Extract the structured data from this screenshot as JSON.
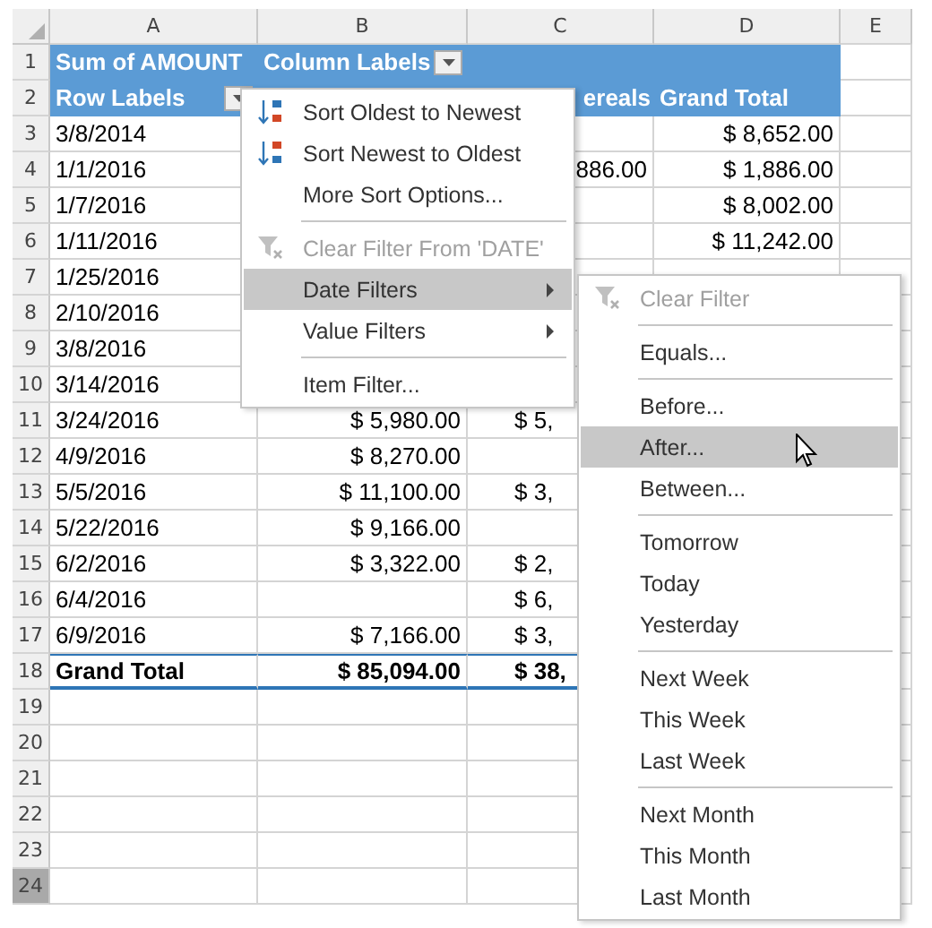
{
  "columns": [
    {
      "label": "A",
      "selected": false
    },
    {
      "label": "B",
      "selected": false
    },
    {
      "label": "C",
      "selected": false
    },
    {
      "label": "D",
      "selected": false
    },
    {
      "label": "E",
      "selected": false
    }
  ],
  "rows": [
    {
      "number": "1",
      "selected": false,
      "kind": "header",
      "cells": [
        {
          "kind": "text",
          "text": "Sum of AMOUNT",
          "filter": false
        },
        {
          "kind": "text",
          "text": "Column Labels",
          "filter": true
        },
        {
          "kind": "blank"
        },
        {
          "kind": "blank"
        },
        {
          "kind": "blank"
        }
      ]
    },
    {
      "number": "2",
      "selected": false,
      "kind": "header",
      "cells": [
        {
          "kind": "text",
          "text": "Row Labels",
          "filter": true
        },
        {
          "kind": "blank"
        },
        {
          "kind": "text",
          "text": "ereals",
          "filter": false
        },
        {
          "kind": "text",
          "text": "Grand Total",
          "filter": false
        },
        {
          "kind": "blank"
        }
      ]
    },
    {
      "number": "3",
      "selected": false,
      "kind": "data",
      "cells": [
        {
          "kind": "text",
          "text": "3/8/2014"
        },
        {
          "kind": "blank"
        },
        {
          "kind": "blank"
        },
        {
          "kind": "text",
          "text": "$ 8,652.00"
        },
        {
          "kind": "blank"
        }
      ]
    },
    {
      "number": "4",
      "selected": false,
      "kind": "data",
      "cells": [
        {
          "kind": "text",
          "text": "1/1/2016"
        },
        {
          "kind": "blank"
        },
        {
          "kind": "text",
          "text": "886.00"
        },
        {
          "kind": "text",
          "text": "$ 1,886.00"
        },
        {
          "kind": "blank"
        }
      ]
    },
    {
      "number": "5",
      "selected": false,
      "kind": "data",
      "cells": [
        {
          "kind": "text",
          "text": "1/7/2016"
        },
        {
          "kind": "blank"
        },
        {
          "kind": "blank"
        },
        {
          "kind": "text",
          "text": "$ 8,002.00"
        },
        {
          "kind": "blank"
        }
      ]
    },
    {
      "number": "6",
      "selected": false,
      "kind": "data",
      "cells": [
        {
          "kind": "text",
          "text": "1/11/2016"
        },
        {
          "kind": "blank"
        },
        {
          "kind": "blank"
        },
        {
          "kind": "text",
          "text": "$ 11,242.00"
        },
        {
          "kind": "blank"
        }
      ]
    },
    {
      "number": "7",
      "selected": false,
      "kind": "data",
      "cells": [
        {
          "kind": "text",
          "text": "1/25/2016"
        },
        {
          "kind": "blank"
        },
        {
          "kind": "blank"
        },
        {
          "kind": "blank"
        },
        {
          "kind": "blank"
        }
      ]
    },
    {
      "number": "8",
      "selected": false,
      "kind": "data",
      "cells": [
        {
          "kind": "text",
          "text": "2/10/2016"
        },
        {
          "kind": "blank"
        },
        {
          "kind": "blank"
        },
        {
          "kind": "blank"
        },
        {
          "kind": "blank"
        }
      ]
    },
    {
      "number": "9",
      "selected": false,
      "kind": "data",
      "cells": [
        {
          "kind": "text",
          "text": "3/8/2016"
        },
        {
          "kind": "blank"
        },
        {
          "kind": "blank"
        },
        {
          "kind": "blank"
        },
        {
          "kind": "blank"
        }
      ]
    },
    {
      "number": "10",
      "selected": false,
      "kind": "data",
      "cells": [
        {
          "kind": "text",
          "text": "3/14/2016"
        },
        {
          "kind": "blank"
        },
        {
          "kind": "blank"
        },
        {
          "kind": "blank"
        },
        {
          "kind": "blank"
        }
      ]
    },
    {
      "number": "11",
      "selected": false,
      "kind": "data",
      "cells": [
        {
          "kind": "text",
          "text": "3/24/2016"
        },
        {
          "kind": "text",
          "text": "$ 5,980.00"
        },
        {
          "kind": "text",
          "text": "$ 5,"
        },
        {
          "kind": "blank"
        },
        {
          "kind": "blank"
        }
      ]
    },
    {
      "number": "12",
      "selected": false,
      "kind": "data",
      "cells": [
        {
          "kind": "text",
          "text": "4/9/2016"
        },
        {
          "kind": "text",
          "text": "$ 8,270.00"
        },
        {
          "kind": "blank"
        },
        {
          "kind": "blank"
        },
        {
          "kind": "blank"
        }
      ]
    },
    {
      "number": "13",
      "selected": false,
      "kind": "data",
      "cells": [
        {
          "kind": "text",
          "text": "5/5/2016"
        },
        {
          "kind": "text",
          "text": "$ 11,100.00"
        },
        {
          "kind": "text",
          "text": "$ 3,"
        },
        {
          "kind": "blank"
        },
        {
          "kind": "blank"
        }
      ]
    },
    {
      "number": "14",
      "selected": false,
      "kind": "data",
      "cells": [
        {
          "kind": "text",
          "text": "5/22/2016"
        },
        {
          "kind": "text",
          "text": "$ 9,166.00"
        },
        {
          "kind": "blank"
        },
        {
          "kind": "blank"
        },
        {
          "kind": "blank"
        }
      ]
    },
    {
      "number": "15",
      "selected": false,
      "kind": "data",
      "cells": [
        {
          "kind": "text",
          "text": "6/2/2016"
        },
        {
          "kind": "text",
          "text": "$ 3,322.00"
        },
        {
          "kind": "text",
          "text": "$ 2,"
        },
        {
          "kind": "blank"
        },
        {
          "kind": "blank"
        }
      ]
    },
    {
      "number": "16",
      "selected": false,
      "kind": "data",
      "cells": [
        {
          "kind": "text",
          "text": "6/4/2016"
        },
        {
          "kind": "blank"
        },
        {
          "kind": "text",
          "text": "$ 6,"
        },
        {
          "kind": "blank"
        },
        {
          "kind": "blank"
        }
      ]
    },
    {
      "number": "17",
      "selected": false,
      "kind": "data",
      "cells": [
        {
          "kind": "text",
          "text": "6/9/2016"
        },
        {
          "kind": "text",
          "text": "$ 7,166.00"
        },
        {
          "kind": "text",
          "text": "$ 3,"
        },
        {
          "kind": "blank"
        },
        {
          "kind": "blank"
        }
      ]
    },
    {
      "number": "18",
      "selected": false,
      "kind": "total",
      "cells": [
        {
          "kind": "text",
          "text": "Grand Total"
        },
        {
          "kind": "text",
          "text": "$ 85,094.00"
        },
        {
          "kind": "text",
          "text": "$ 38,"
        },
        {
          "kind": "blank"
        },
        {
          "kind": "blank"
        }
      ]
    },
    {
      "number": "19",
      "selected": false,
      "kind": "empty",
      "cells": []
    },
    {
      "number": "20",
      "selected": false,
      "kind": "empty",
      "cells": []
    },
    {
      "number": "21",
      "selected": false,
      "kind": "empty",
      "cells": []
    },
    {
      "number": "22",
      "selected": false,
      "kind": "empty",
      "cells": []
    },
    {
      "number": "23",
      "selected": false,
      "kind": "empty",
      "cells": []
    },
    {
      "number": "24",
      "selected": true,
      "kind": "empty",
      "cells": []
    }
  ],
  "menu": {
    "items": [
      {
        "kind": "sortasc",
        "label": "Sort Oldest to Newest",
        "disabled": false,
        "selected": false,
        "submenu": false
      },
      {
        "kind": "sortdesc",
        "label": "Sort Newest to Oldest",
        "disabled": false,
        "selected": false,
        "submenu": false
      },
      {
        "kind": "item",
        "label": "More Sort Options...",
        "disabled": false,
        "selected": false,
        "submenu": false
      },
      {
        "kind": "separator"
      },
      {
        "kind": "clear",
        "label": "Clear Filter From 'DATE'",
        "disabled": true,
        "selected": false,
        "submenu": false
      },
      {
        "kind": "item",
        "label": "Date Filters",
        "disabled": false,
        "selected": true,
        "submenu": true
      },
      {
        "kind": "item",
        "label": "Value Filters",
        "disabled": false,
        "selected": false,
        "submenu": true
      },
      {
        "kind": "separator"
      },
      {
        "kind": "item",
        "label": "Item Filter...",
        "disabled": false,
        "selected": false,
        "submenu": false
      }
    ]
  },
  "submenu": {
    "items": [
      {
        "kind": "clear",
        "label": "Clear Filter",
        "disabled": true,
        "selected": false
      },
      {
        "kind": "separator"
      },
      {
        "kind": "item",
        "label": "Equals...",
        "disabled": false,
        "selected": false
      },
      {
        "kind": "separator"
      },
      {
        "kind": "item",
        "label": "Before...",
        "disabled": false,
        "selected": false
      },
      {
        "kind": "item",
        "label": "After...",
        "disabled": false,
        "selected": true
      },
      {
        "kind": "item",
        "label": "Between...",
        "disabled": false,
        "selected": false
      },
      {
        "kind": "separator"
      },
      {
        "kind": "item",
        "label": "Tomorrow",
        "disabled": false,
        "selected": false
      },
      {
        "kind": "item",
        "label": "Today",
        "disabled": false,
        "selected": false
      },
      {
        "kind": "item",
        "label": "Yesterday",
        "disabled": false,
        "selected": false
      },
      {
        "kind": "separator"
      },
      {
        "kind": "item",
        "label": "Next Week",
        "disabled": false,
        "selected": false
      },
      {
        "kind": "item",
        "label": "This Week",
        "disabled": false,
        "selected": false
      },
      {
        "kind": "item",
        "label": "Last Week",
        "disabled": false,
        "selected": false
      },
      {
        "kind": "separator"
      },
      {
        "kind": "item",
        "label": "Next Month",
        "disabled": false,
        "selected": false
      },
      {
        "kind": "item",
        "label": "This Month",
        "disabled": false,
        "selected": false
      },
      {
        "kind": "item",
        "label": "Last Month",
        "disabled": false,
        "selected": false
      }
    ]
  }
}
